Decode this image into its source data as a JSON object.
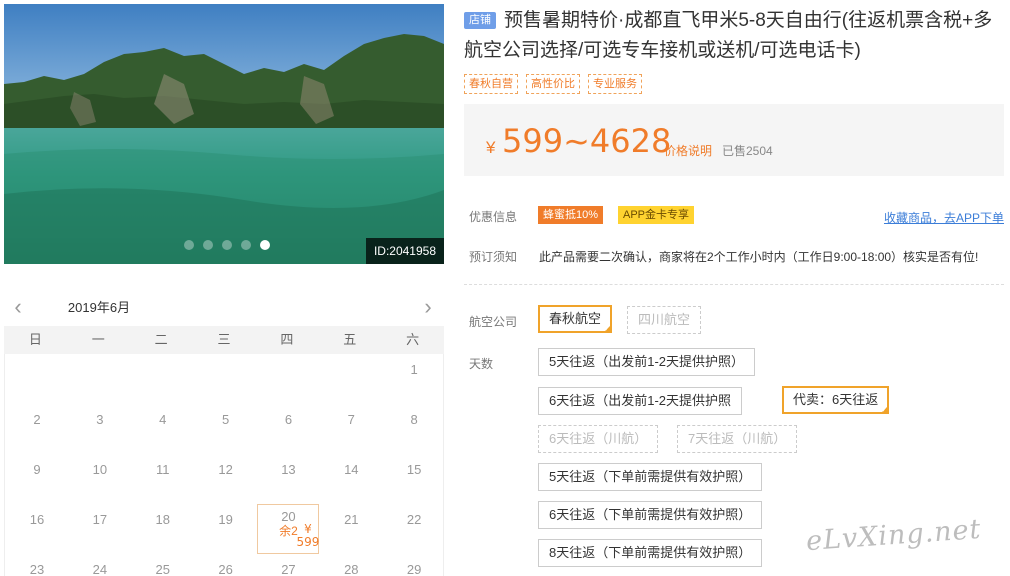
{
  "photo": {
    "id_label": "ID:2041958",
    "slides": 5,
    "active_slide": 5
  },
  "calendar": {
    "month_label": "2019年6月",
    "prev_icon": "chevron-left-icon",
    "next_icon": "chevron-right-icon",
    "weekdays": [
      "日",
      "一",
      "二",
      "三",
      "四",
      "五",
      "六"
    ],
    "rows": [
      [
        "",
        "",
        "",
        "",
        "",
        "",
        "1"
      ],
      [
        "2",
        "3",
        "4",
        "5",
        "6",
        "7",
        "8"
      ],
      [
        "9",
        "10",
        "11",
        "12",
        "13",
        "14",
        "15"
      ],
      [
        "16",
        "17",
        "18",
        "19",
        "20",
        "21",
        "22"
      ],
      [
        "23",
        "24",
        "25",
        "26",
        "27",
        "28",
        "29"
      ]
    ],
    "available_day": {
      "day": "20",
      "price": "¥ 599",
      "left": "余2"
    }
  },
  "product": {
    "shop_tag": "店铺",
    "title": "预售暑期特价·成都直飞甲米5-8天自由行(往返机票含税+多航空公司选择/可选专车接机或送机/可选电话卡)",
    "tags": [
      "春秋自营",
      "高性价比",
      "专业服务"
    ],
    "currency": "¥",
    "price": "599~4628",
    "price_note": "价格说明",
    "sold": "已售2504"
  },
  "offers": {
    "label": "优惠信息",
    "badge_discount": "蜂蜜抵10%",
    "badge_app": "APP金卡专享",
    "collect_link": "收藏商品，去APP下单"
  },
  "booking": {
    "label": "预订须知",
    "notice": "此产品需要二次确认，商家将在2个工作小时内（工作日9:00-18:00）核实是否有位!"
  },
  "airline": {
    "label": "航空公司",
    "options": [
      {
        "label": "春秋航空",
        "state": "selected"
      },
      {
        "label": "四川航空",
        "state": "disabled"
      }
    ]
  },
  "days": {
    "label": "天数",
    "options": [
      {
        "label": "5天往返（出发前1-2天提供护照）",
        "state": "normal"
      },
      {
        "label": "6天往返（出发前1-2天提供护照",
        "state": "normal"
      },
      {
        "label": "代卖：6天往返",
        "state": "selected"
      },
      {
        "label": "6天往返（川航）",
        "state": "disabled"
      },
      {
        "label": "7天往返（川航）",
        "state": "disabled"
      },
      {
        "label": "5天往返（下单前需提供有效护照）",
        "state": "normal"
      },
      {
        "label": "6天往返（下单前需提供有效护照）",
        "state": "normal"
      },
      {
        "label": "8天往返（下单前需提供有效护照）",
        "state": "normal"
      }
    ]
  },
  "watermark": "eLvXing.net",
  "colors": {
    "accent_orange": "#f07c2a",
    "selected_border": "#f0a32a",
    "link_blue": "#3b7dd8",
    "shop_tag_blue": "#6f9ee8"
  }
}
